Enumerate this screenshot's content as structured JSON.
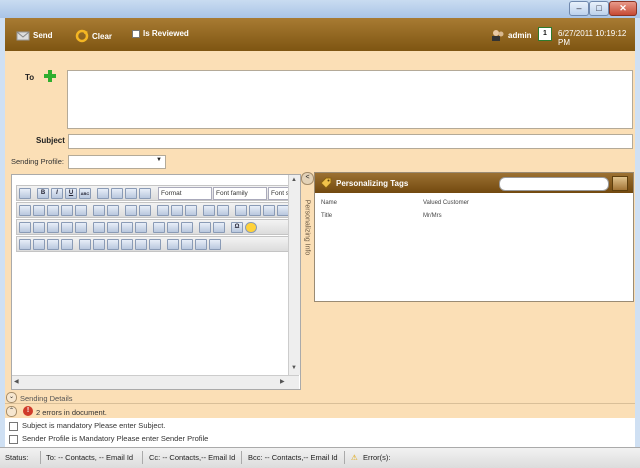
{
  "window": {
    "minimize": "–",
    "maximize": "□",
    "close": "✕"
  },
  "toolbar": {
    "send_label": "Send",
    "clear_label": "Clear",
    "is_reviewed_label": "Is Reviewed",
    "user": "admin",
    "calendar_day": "1",
    "datetime": "6/27/2011 10:19:12 PM"
  },
  "form": {
    "to_label": "To",
    "subject_label": "Subject",
    "subject_value": "",
    "sending_profile_label": "Sending Profile:",
    "sending_profile_value": ""
  },
  "editor": {
    "format_label": "Format",
    "font_family_label": "Font family",
    "font_size_label": "Font s",
    "row1": [
      "B",
      "I",
      "U",
      "ABC"
    ],
    "omega": "Ω"
  },
  "side_tab": {
    "label": "Personalizing Info",
    "collapse": "<"
  },
  "tags": {
    "title": "Personalizing Tags",
    "search_value": "",
    "rows": [
      {
        "name": "Name",
        "value": "Valued Customer"
      },
      {
        "name": "Title",
        "value": "Mr/Mrs"
      }
    ]
  },
  "sending_details": {
    "label": "Sending Details"
  },
  "errors": {
    "summary": "2 errors in document.",
    "items": [
      "Subject is mandatory Please enter Subject.",
      "Sender Profile is Mandatory Please enter Sender Profile"
    ]
  },
  "status": {
    "status_label": "Status:",
    "to": "To: -- Contacts, -- Email Id",
    "cc": "Cc: -- Contacts,-- Email Id",
    "bcc": "Bcc: -- Contacts,-- Email Id",
    "errors": "Error(s):"
  },
  "colors": {
    "toolbar": "#8a601d",
    "panel": "#fbdfb6",
    "accent_green": "#2fae2f",
    "error_red": "#d03a2a"
  }
}
